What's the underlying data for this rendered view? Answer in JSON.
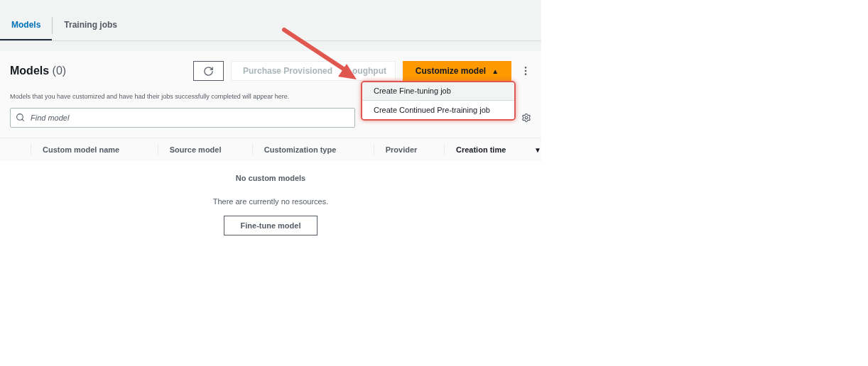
{
  "tabs": [
    {
      "label": "Models",
      "selected": true
    },
    {
      "label": "Training jobs",
      "selected": false
    }
  ],
  "header": {
    "title": "Models",
    "count": "(0)",
    "description": "Models that you have customized and have had their jobs successfully completed will appear here."
  },
  "actions": {
    "secondary": [
      "Purchase Provisioned",
      "oughput"
    ],
    "primary": "Customize model",
    "primary_caret": "▲"
  },
  "menu": [
    {
      "label": "Create Fine-tuning job",
      "selected": true
    },
    {
      "label": "Create Continued Pre-training job",
      "selected": false
    }
  ],
  "search": {
    "placeholder": "Find model"
  },
  "table": {
    "columns": [
      {
        "label": "Custom model name",
        "sorted": false
      },
      {
        "label": "Source model",
        "sorted": false
      },
      {
        "label": "Customization type",
        "sorted": false
      },
      {
        "label": "Provider",
        "sorted": false
      },
      {
        "label": "Creation time",
        "sorted": true
      }
    ],
    "sort_caret": "▼",
    "empty_title": "No custom models",
    "empty_text": "There are currently no resources.",
    "empty_button": "Fine-tune model"
  }
}
